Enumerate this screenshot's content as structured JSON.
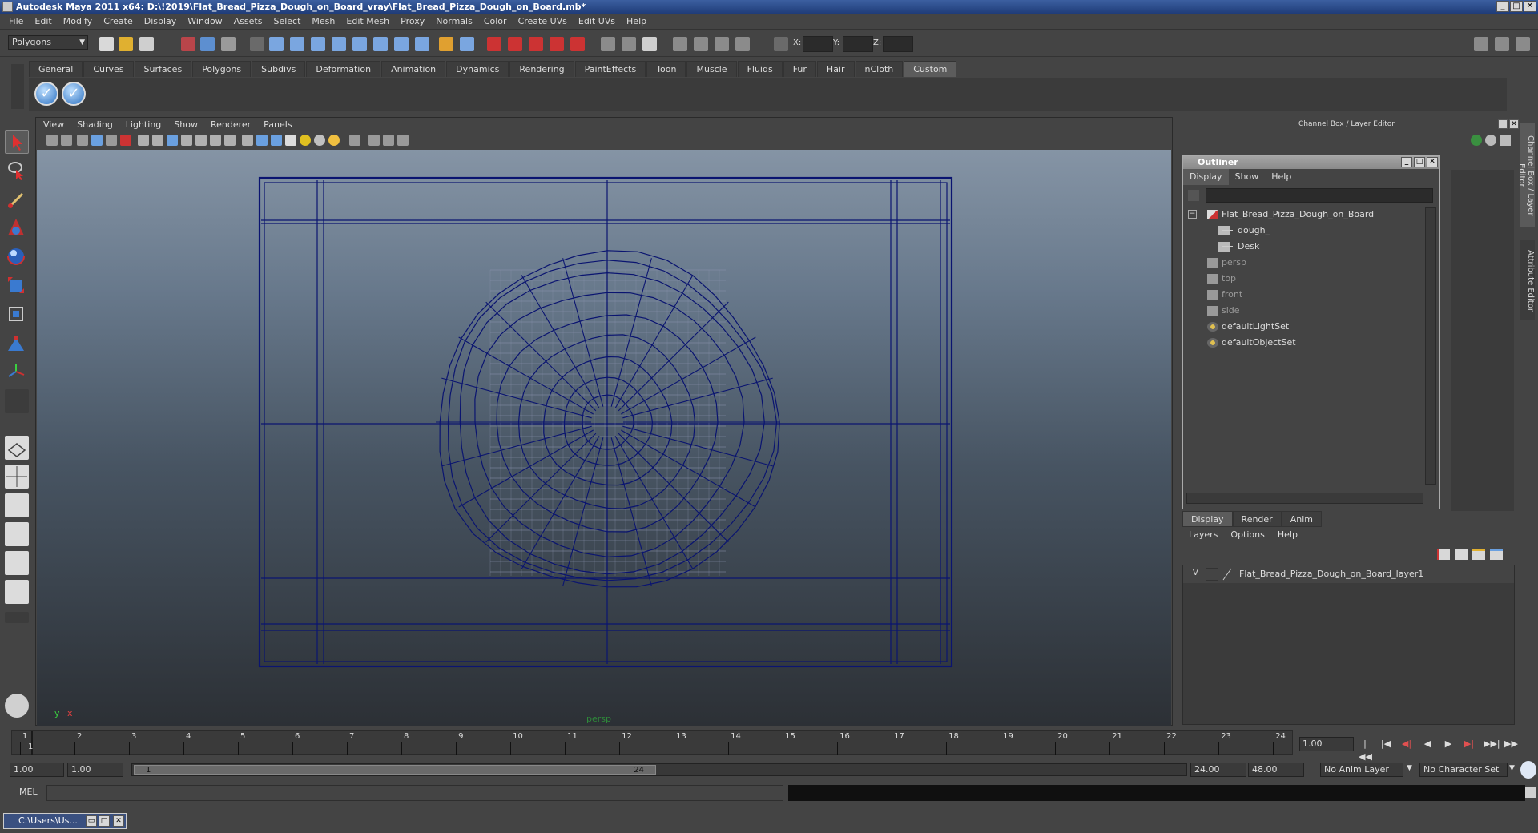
{
  "window": {
    "title": "Autodesk Maya 2011 x64: D:\\!2019\\Flat_Bread_Pizza_Dough_on_Board_vray\\Flat_Bread_Pizza_Dough_on_Board.mb*",
    "buttons": [
      "_",
      "□",
      "✕"
    ]
  },
  "menubar": [
    "File",
    "Edit",
    "Modify",
    "Create",
    "Display",
    "Window",
    "Assets",
    "Select",
    "Mesh",
    "Edit Mesh",
    "Proxy",
    "Normals",
    "Color",
    "Create UVs",
    "Edit UVs",
    "Help"
  ],
  "statusline": {
    "mode": "Polygons",
    "x_label": "X:",
    "y_label": "Y:",
    "z_label": "Z:"
  },
  "shelf": {
    "tabs": [
      "General",
      "Curves",
      "Surfaces",
      "Polygons",
      "Subdivs",
      "Deformation",
      "Animation",
      "Dynamics",
      "Rendering",
      "PaintEffects",
      "Toon",
      "Muscle",
      "Fluids",
      "Fur",
      "Hair",
      "nCloth",
      "Custom"
    ],
    "active_tab": "Custom",
    "button_glyph": "✓"
  },
  "viewport": {
    "menu": [
      "View",
      "Shading",
      "Lighting",
      "Show",
      "Renderer",
      "Panels"
    ],
    "camera_label": "persp",
    "axis_y": "y",
    "axis_x": "x",
    "wire_color": "#0a1470"
  },
  "right_panel": {
    "header": "Channel Box / Layer Editor",
    "side_tabs": [
      "Channel Box / Layer Editor",
      "Attribute Editor"
    ]
  },
  "outliner": {
    "title": "Outliner",
    "menu": [
      "Display",
      "Show",
      "Help"
    ],
    "active_menu": "Display",
    "items": [
      {
        "label": "Flat_Bread_Pizza_Dough_on_Board",
        "indent": 0,
        "dim": false,
        "icon": "group-icon",
        "expander": "−"
      },
      {
        "label": "dough_",
        "indent": 1,
        "dim": false,
        "icon": "mesh-icon"
      },
      {
        "label": "Desk",
        "indent": 1,
        "dim": false,
        "icon": "mesh-icon"
      },
      {
        "label": "persp",
        "indent": 0,
        "dim": true,
        "icon": "camera-icon"
      },
      {
        "label": "top",
        "indent": 0,
        "dim": true,
        "icon": "camera-icon"
      },
      {
        "label": "front",
        "indent": 0,
        "dim": true,
        "icon": "camera-icon"
      },
      {
        "label": "side",
        "indent": 0,
        "dim": true,
        "icon": "camera-icon"
      },
      {
        "label": "defaultLightSet",
        "indent": 0,
        "dim": false,
        "icon": "set-icon"
      },
      {
        "label": "defaultObjectSet",
        "indent": 0,
        "dim": false,
        "icon": "set-icon"
      }
    ]
  },
  "layer_editor": {
    "tabs": [
      "Display",
      "Render",
      "Anim"
    ],
    "active_tab": "Display",
    "menu": [
      "Layers",
      "Options",
      "Help"
    ],
    "layer": {
      "visibility": "V",
      "name": "Flat_Bread_Pizza_Dough_on_Board_layer1"
    }
  },
  "timeline": {
    "ticks": [
      "1",
      "2",
      "3",
      "4",
      "5",
      "6",
      "7",
      "8",
      "9",
      "10",
      "11",
      "12",
      "13",
      "14",
      "15",
      "16",
      "17",
      "18",
      "19",
      "20",
      "21",
      "22",
      "23",
      "24"
    ],
    "current_frame_marker": "1",
    "current_frame": "1.00",
    "controls": [
      "|◀◀",
      "|◀",
      "◀|",
      "◀",
      "▶",
      "▶|",
      "▶▶|",
      "▶▶"
    ]
  },
  "range": {
    "start_time": "1.00",
    "playback_start": "1.00",
    "thumb_start": "1",
    "thumb_end": "24",
    "playback_end": "24.00",
    "end_time": "48.00",
    "anim_layer": "No Anim Layer",
    "character_set": "No Character Set"
  },
  "command_line": {
    "label": "MEL"
  },
  "taskbar": {
    "item": "C:\\Users\\Us..."
  }
}
